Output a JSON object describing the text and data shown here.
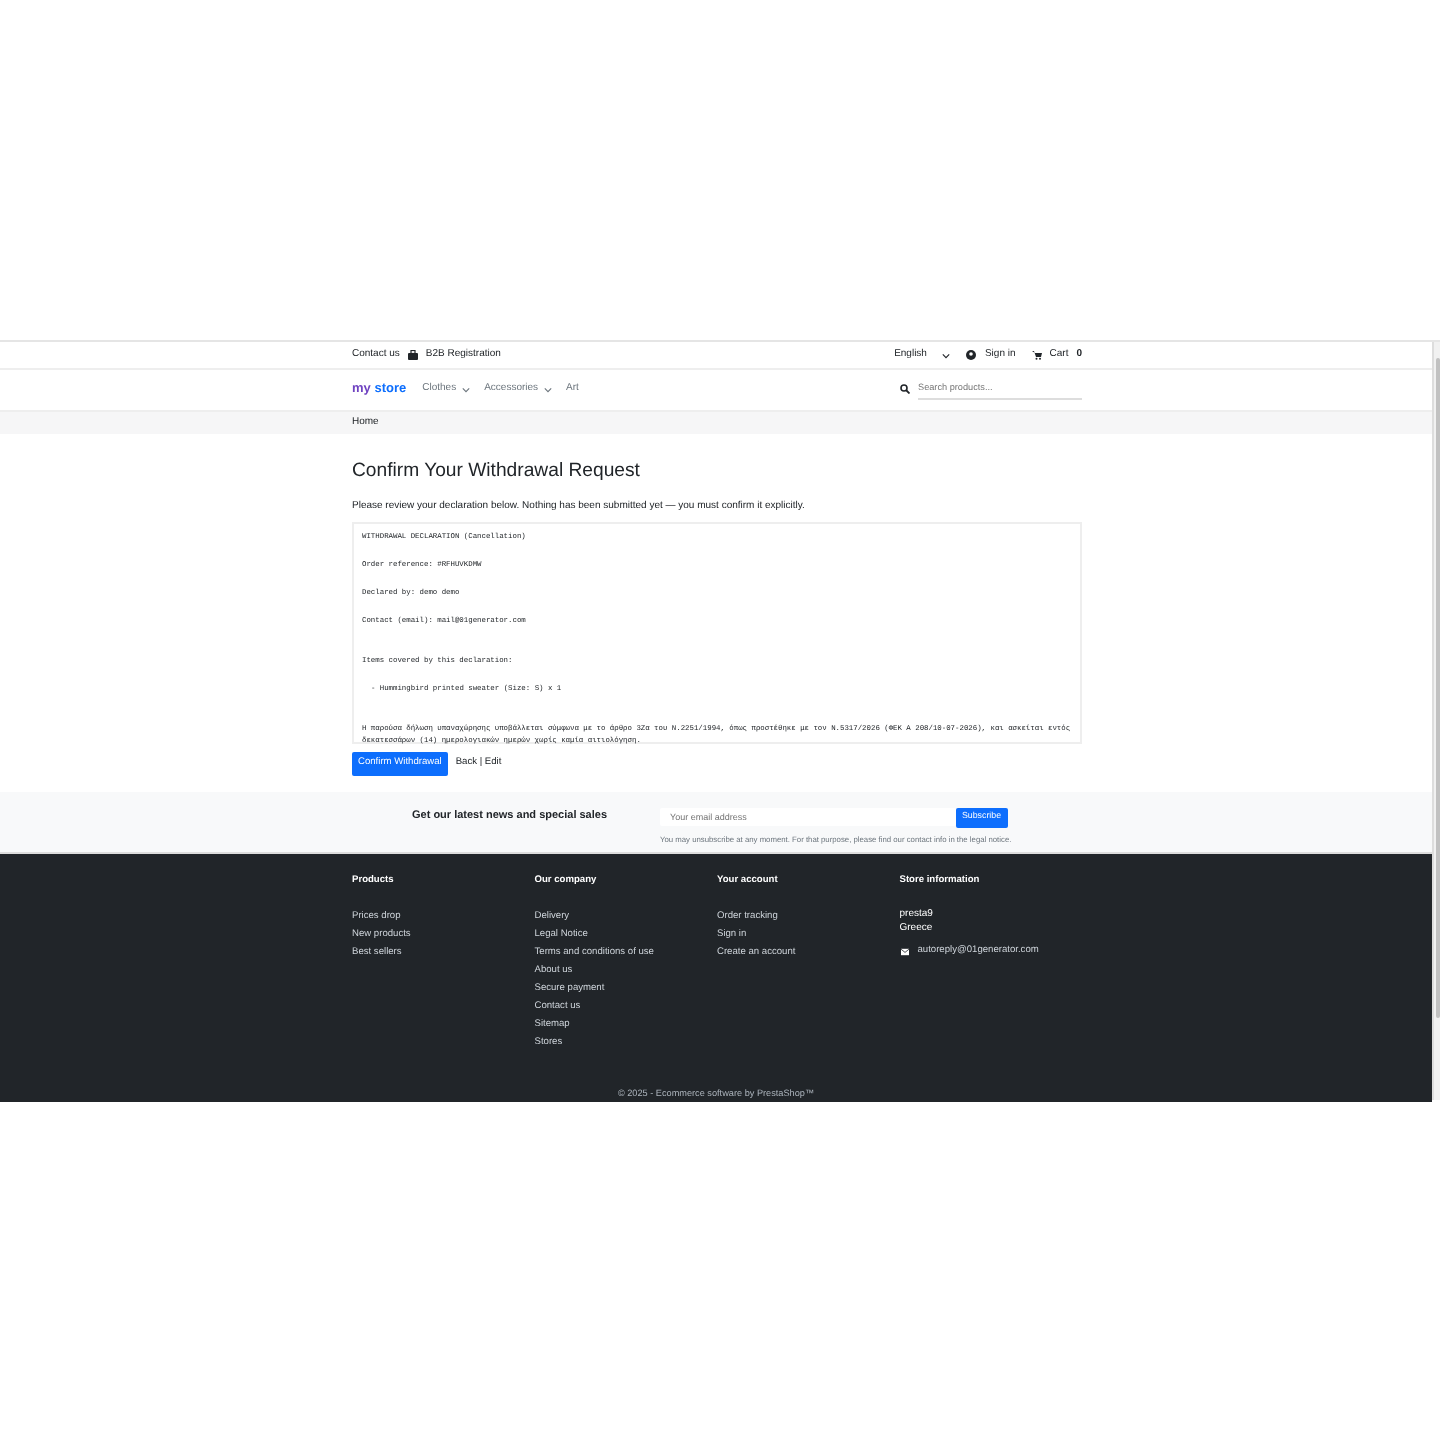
{
  "topbar": {
    "contact": "Contact us",
    "b2b": "B2B Registration",
    "language": "English",
    "sign_in": "Sign in",
    "cart": "Cart",
    "cart_count": "0"
  },
  "header": {
    "logo_first": "my",
    "logo_second": "store",
    "menu": [
      {
        "label": "Clothes",
        "dropdown": true
      },
      {
        "label": "Accessories",
        "dropdown": true
      },
      {
        "label": "Art",
        "dropdown": false
      }
    ],
    "search": {
      "placeholder": "Search products..."
    }
  },
  "breadcrumb": [
    "Home"
  ],
  "heading": "Confirm Your Withdrawal Request",
  "intro": "Please review your declaration below. Nothing has been submitted yet — you must confirm it explicitly.",
  "declaration": [
    "WITHDRAWAL DECLARATION (Cancellation)",
    "Order reference: #RFHUVKDMW",
    "Declared by: demo demo",
    "Contact (email): mail@01generator.com",
    "Items covered by this declaration:",
    "  - Hummingbird printed sweater (Size: S) x 1",
    "Η παρούσα δήλωση υπαναχώρησης υποβάλλεται σύμφωνα με το άρθρο 3Ζα του Ν.2251/1994, όπως προστέθηκε με τον Ν.5317/2026 (ΦΕΚ Α 208/10-07-2026), και ασκείται εντός δεκατεσσάρων (14) ημερολογιακών ημερών χωρίς καμία αιτιολόγηση."
  ],
  "actions": {
    "confirm": "Confirm Withdrawal",
    "back": "Back | Edit"
  },
  "newsletter": {
    "title": "Get our latest news and special sales",
    "placeholder": "Your email address",
    "button": "Subscribe",
    "note": "You may unsubscribe at any moment. For that purpose, please find our contact info in the legal notice."
  },
  "footer": {
    "columns": [
      {
        "title": "Products",
        "links": [
          "Prices drop",
          "New products",
          "Best sellers"
        ]
      },
      {
        "title": "Our company",
        "links": [
          "Delivery",
          "Legal Notice",
          "Terms and conditions of use",
          "About us",
          "Secure payment",
          "Contact us",
          "Sitemap",
          "Stores"
        ]
      },
      {
        "title": "Your account",
        "links": [
          "Order tracking",
          "Sign in",
          "Create an account"
        ]
      }
    ],
    "store": {
      "title": "Store information",
      "lines": [
        "presta9",
        "Greece"
      ],
      "email": "autoreply@01generator.com"
    },
    "copyright": "© 2025 - Ecommerce software by PrestaShop™"
  }
}
